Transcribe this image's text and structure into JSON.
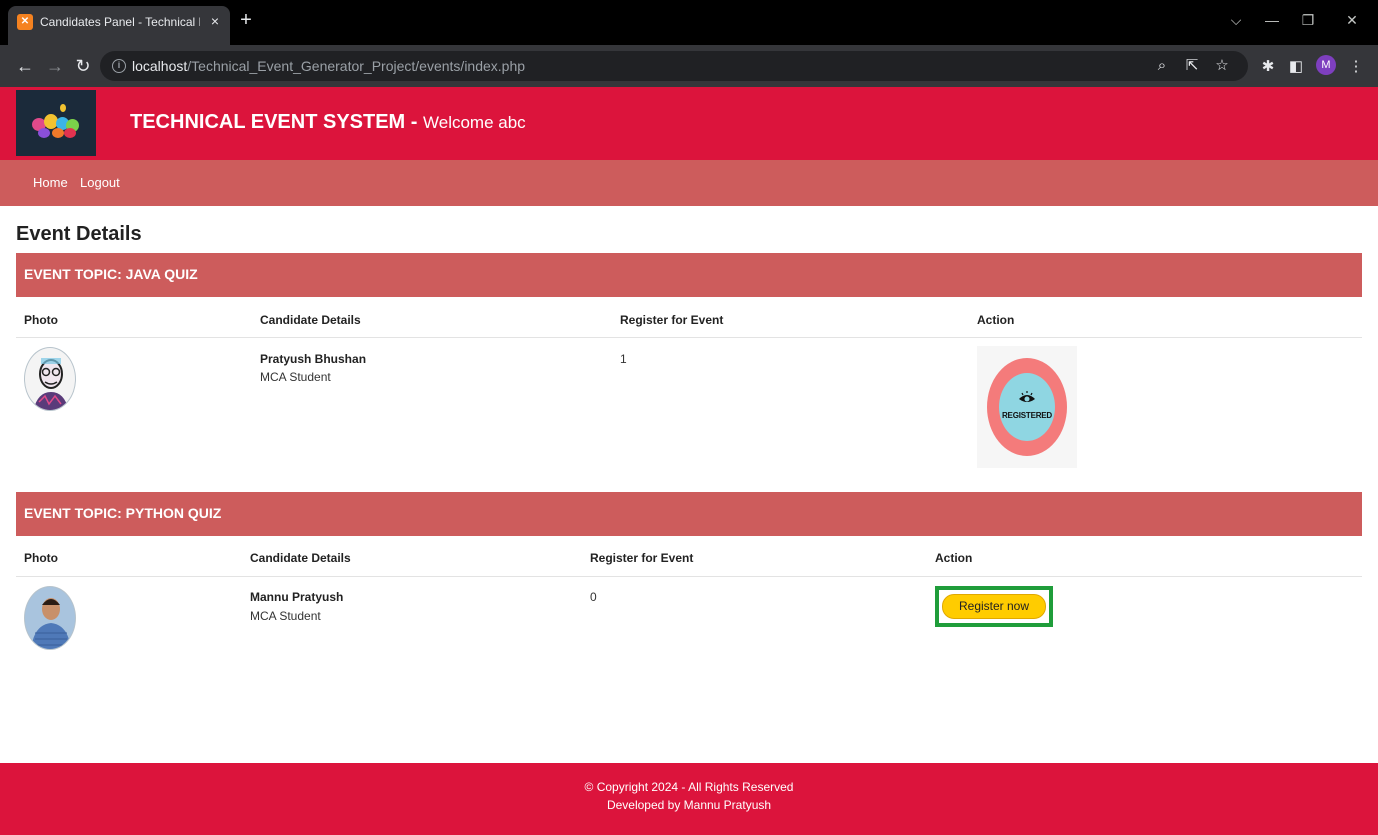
{
  "browser": {
    "tab_title": "Candidates Panel - Technical Eve",
    "tab_close": "×",
    "new_tab": "+",
    "url_host": "localhost",
    "url_path": "/Technical_Event_Generator_Project/events/index.php",
    "profile_initial": "M"
  },
  "header": {
    "title": "TECHNICAL EVENT SYSTEM",
    "separator": " - ",
    "welcome": "Welcome abc"
  },
  "nav": {
    "home": "Home",
    "logout": "Logout"
  },
  "page": {
    "title": "Event Details"
  },
  "columns": {
    "photo": "Photo",
    "candidate": "Candidate Details",
    "register": "Register for Event",
    "action": "Action"
  },
  "events": [
    {
      "topic": "EVENT TOPIC: JAVA QUIZ",
      "candidate_name": "Pratyush Bhushan",
      "candidate_role": "MCA Student",
      "register_count": "1",
      "action_status": "REGISTERED"
    },
    {
      "topic": "EVENT TOPIC: PYTHON QUIZ",
      "candidate_name": "Mannu Pratyush",
      "candidate_role": "MCA Student",
      "register_count": "0",
      "action_button": "Register now"
    }
  ],
  "footer": {
    "copyright": "© Copyright 2024 - All Rights Reserved",
    "developer": "Developed by Mannu Pratyush"
  },
  "colors": {
    "header_bg": "#dc143c",
    "nav_bg": "#cd5c5c",
    "event_bar_bg": "#cd5c5c",
    "button_bg": "#ffcc00",
    "button_frame": "#1f9d3a"
  }
}
